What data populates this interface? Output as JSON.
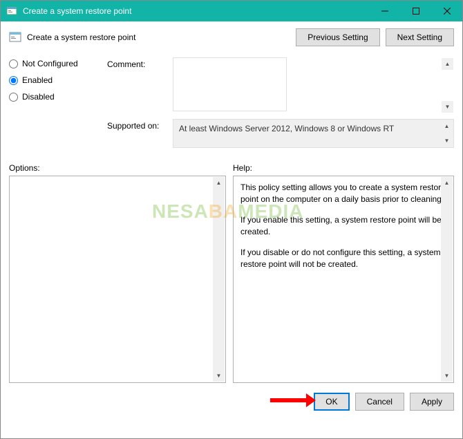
{
  "window": {
    "title": "Create a system restore point"
  },
  "header": {
    "title": "Create a system restore point",
    "prev_btn": "Previous Setting",
    "next_btn": "Next Setting"
  },
  "radios": {
    "not_configured": "Not Configured",
    "enabled": "Enabled",
    "disabled": "Disabled"
  },
  "fields": {
    "comment_label": "Comment:",
    "comment_value": "",
    "supported_label": "Supported on:",
    "supported_value": "At least Windows Server 2012, Windows 8 or Windows RT"
  },
  "labels": {
    "options": "Options:",
    "help": "Help:"
  },
  "help": {
    "p1": "This policy setting allows you to create a system restore point on the computer on a daily basis prior to cleaning.",
    "p2": "If you enable this setting, a system restore point will be created.",
    "p3": "If you disable or do not configure this setting, a system restore point will not be created."
  },
  "footer": {
    "ok": "OK",
    "cancel": "Cancel",
    "apply": "Apply"
  },
  "watermark": {
    "part1": "NESA",
    "part2": "BA",
    "part3": "MEDIA"
  }
}
